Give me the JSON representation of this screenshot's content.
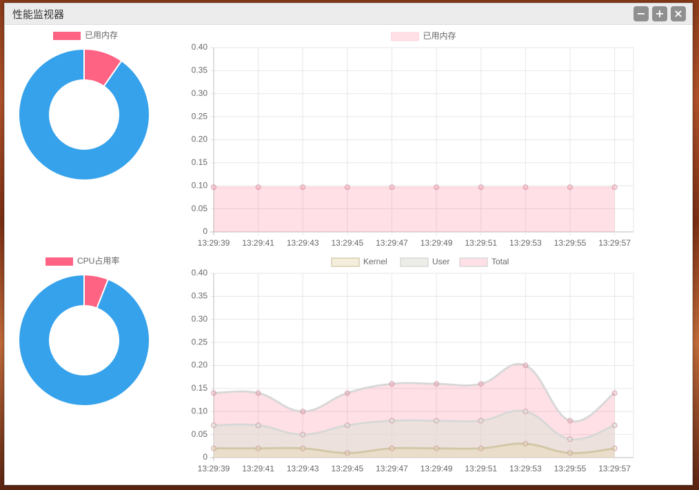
{
  "window": {
    "title": "性能监视器",
    "buttons": {
      "minimize": "−",
      "maximize": "+",
      "close": "×"
    }
  },
  "colors": {
    "pink": "#ff6384",
    "blue": "#36a2eb",
    "pink_fill": "rgba(255,99,132,0.2)",
    "kernel_fill": "rgba(230,220,180,0.45)",
    "user_fill": "rgba(200,240,230,0.45)",
    "line_grey": "#d8d8d8"
  },
  "chart_data": [
    {
      "id": "memory-donut",
      "type": "pie",
      "donut": true,
      "legend": [
        "已用内存"
      ],
      "values": [
        0.097,
        0.903
      ],
      "colors": [
        "#ff6384",
        "#36a2eb"
      ]
    },
    {
      "id": "memory-line",
      "type": "area",
      "legend": [
        "已用内存"
      ],
      "x": [
        "13:29:39",
        "13:29:41",
        "13:29:43",
        "13:29:45",
        "13:29:47",
        "13:29:49",
        "13:29:51",
        "13:29:53",
        "13:29:55",
        "13:29:57"
      ],
      "ylim": [
        0,
        0.4
      ],
      "yticks": [
        "0",
        "0.05",
        "0.10",
        "0.15",
        "0.20",
        "0.25",
        "0.30",
        "0.35",
        "0.40"
      ],
      "series": [
        {
          "name": "已用内存",
          "values": [
            0.097,
            0.097,
            0.097,
            0.097,
            0.097,
            0.097,
            0.097,
            0.097,
            0.097,
            0.097
          ]
        }
      ]
    },
    {
      "id": "cpu-donut",
      "type": "pie",
      "donut": true,
      "legend": [
        "CPU占用率"
      ],
      "values": [
        0.06,
        0.94
      ],
      "colors": [
        "#ff6384",
        "#36a2eb"
      ]
    },
    {
      "id": "cpu-line",
      "type": "area",
      "legend": [
        "Kernel",
        "User",
        "Total"
      ],
      "x": [
        "13:29:39",
        "13:29:41",
        "13:29:43",
        "13:29:45",
        "13:29:47",
        "13:29:49",
        "13:29:51",
        "13:29:53",
        "13:29:55",
        "13:29:57"
      ],
      "ylim": [
        0,
        0.4
      ],
      "yticks": [
        "0",
        "0.05",
        "0.10",
        "0.15",
        "0.20",
        "0.25",
        "0.30",
        "0.35",
        "0.40"
      ],
      "series": [
        {
          "name": "Kernel",
          "values": [
            0.02,
            0.02,
            0.02,
            0.01,
            0.02,
            0.02,
            0.02,
            0.03,
            0.01,
            0.02
          ]
        },
        {
          "name": "User",
          "values": [
            0.07,
            0.07,
            0.05,
            0.07,
            0.08,
            0.08,
            0.08,
            0.1,
            0.04,
            0.07
          ]
        },
        {
          "name": "Total",
          "values": [
            0.14,
            0.14,
            0.1,
            0.14,
            0.16,
            0.16,
            0.16,
            0.2,
            0.08,
            0.14
          ]
        }
      ]
    }
  ]
}
